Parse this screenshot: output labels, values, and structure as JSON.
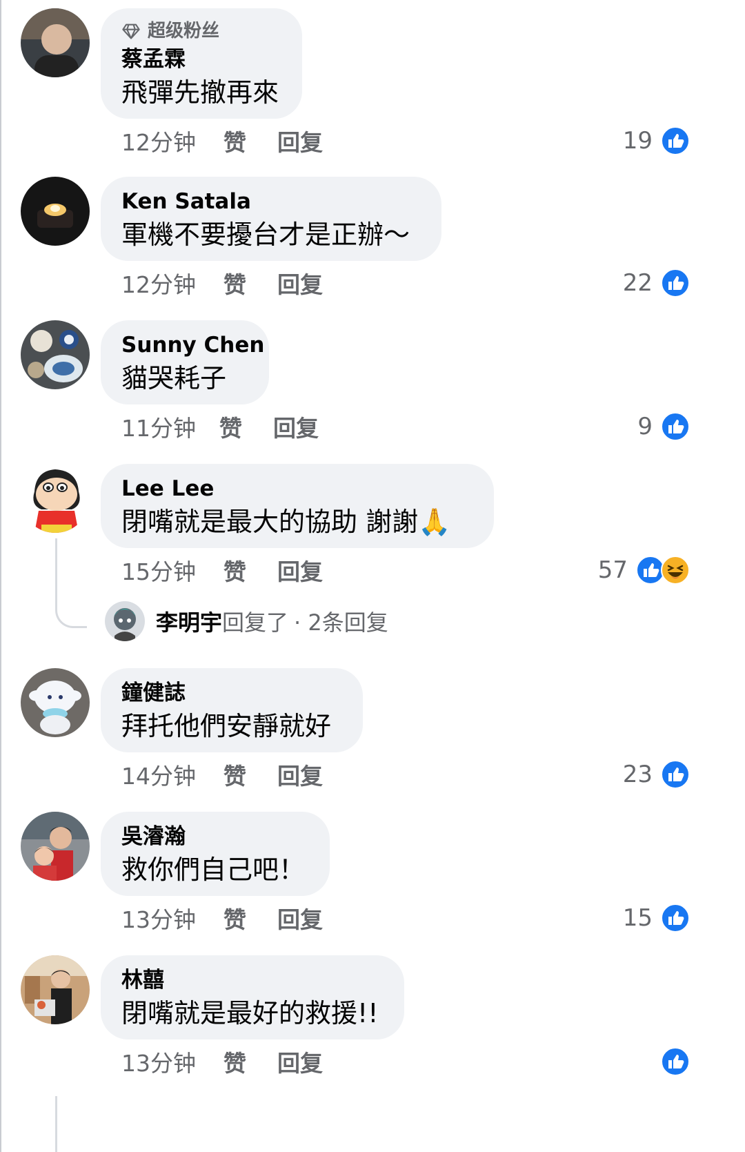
{
  "comments": [
    {
      "badge": "超级粉丝",
      "author": "蔡孟霖",
      "text": "飛彈先撤再來",
      "time": "12分钟",
      "like_label": "赞",
      "reply_label": "回复",
      "reaction_count": "19",
      "reactions": [
        "like-icon"
      ]
    },
    {
      "author": "Ken Satala",
      "text": "軍機不要擾台才是正辦～",
      "time": "12分钟",
      "like_label": "赞",
      "reply_label": "回复",
      "reaction_count": "22",
      "reactions": [
        "like-icon"
      ]
    },
    {
      "author": "Sunny Chen",
      "text": "貓哭耗子",
      "time": "11分钟",
      "like_label": "赞",
      "reply_label": "回复",
      "reaction_count": "9",
      "reactions": [
        "like-icon"
      ]
    },
    {
      "author": "Lee Lee",
      "text": "閉嘴就是最大的協助 謝謝🙏",
      "time": "15分钟",
      "like_label": "赞",
      "reply_label": "回复",
      "reaction_count": "57",
      "reactions": [
        "like-icon",
        "haha-icon"
      ],
      "replies": {
        "name": "李明宇",
        "action": "回复了",
        "count": "· 2条回复"
      }
    },
    {
      "author": "鐘健誌",
      "text": "拜托他們安靜就好",
      "time": "14分钟",
      "like_label": "赞",
      "reply_label": "回复",
      "reaction_count": "23",
      "reactions": [
        "like-icon"
      ]
    },
    {
      "author": "吳濬瀚",
      "text": "救你們自己吧！",
      "time": "13分钟",
      "like_label": "赞",
      "reply_label": "回复",
      "reaction_count": "15",
      "reactions": [
        "like-icon"
      ]
    },
    {
      "author": "林囍",
      "text": "閉嘴就是最好的救援!!",
      "time": "13分钟",
      "like_label": "赞",
      "reply_label": "回复",
      "reaction_count": "",
      "reactions": [
        "like-icon"
      ]
    }
  ],
  "colors": {
    "bubble": "#f0f2f5",
    "like_blue": "#1877f2",
    "muted_text": "#65676b",
    "haha_yellow": "#f7b125"
  }
}
